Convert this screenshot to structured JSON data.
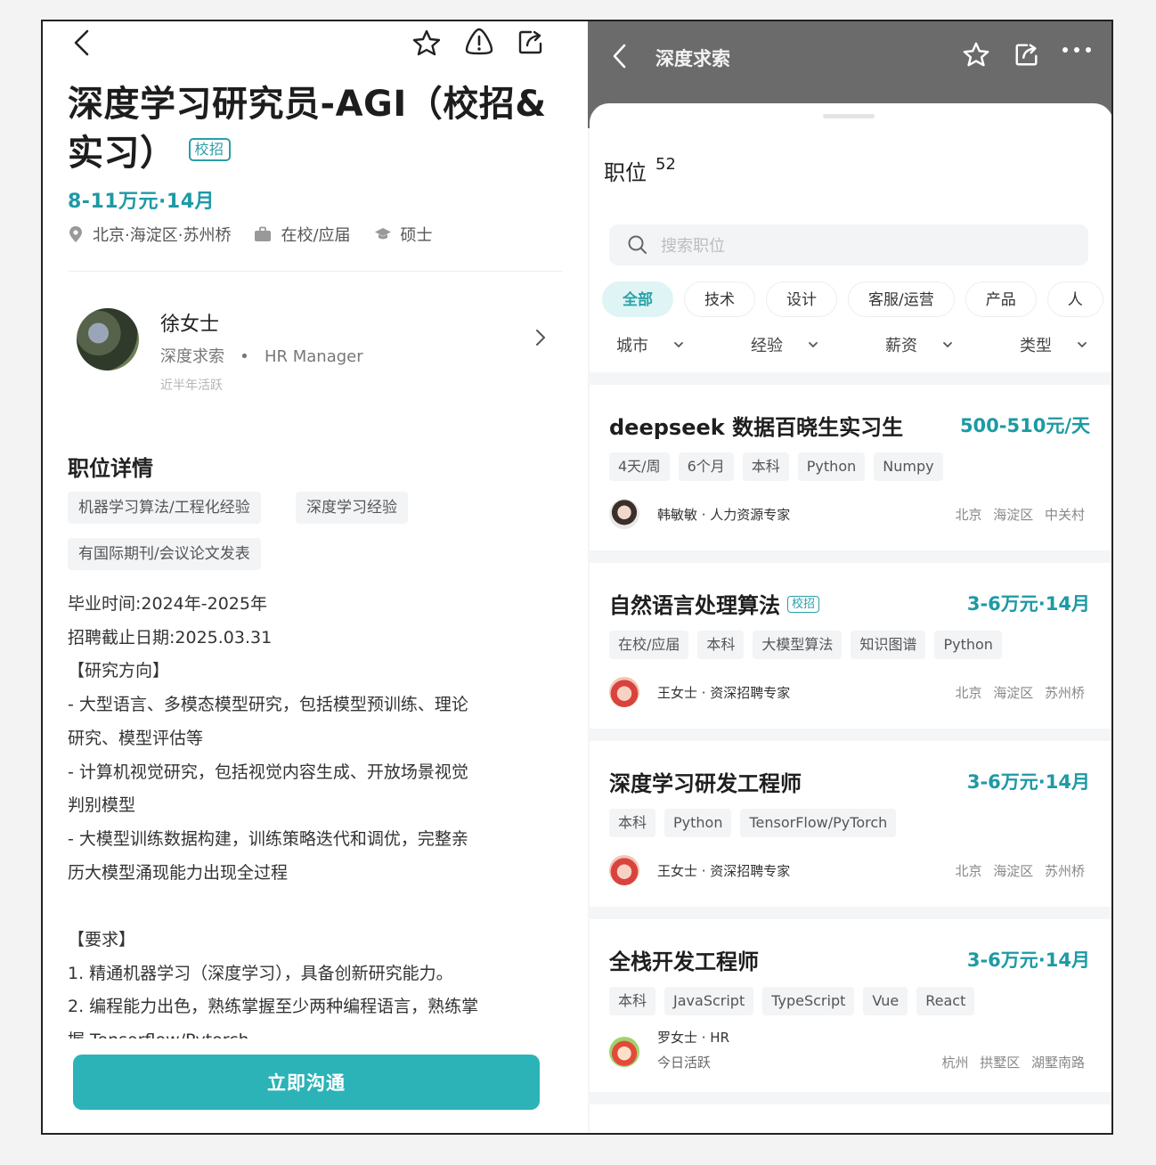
{
  "colors": {
    "accent": "#1d9aa4",
    "button": "#2bb3b8",
    "header_gray": "#6b6b6b"
  },
  "left": {
    "icons": [
      "back-icon",
      "star-icon",
      "alert-icon",
      "share-icon"
    ],
    "title": "深度学习研究员-AGI（校招&实习）",
    "title_badge": "校招",
    "salary": "8-11万元·14月",
    "location": "北京·海淀区·苏州桥",
    "status": "在校/应届",
    "degree": "硕士",
    "hr": {
      "name": "徐女士",
      "company": "深度求索",
      "role": "HR Manager",
      "active": "近半年活跃"
    },
    "detail_heading": "职位详情",
    "skills": [
      "机器学习算法/工程化经验",
      "深度学习经验",
      "有国际期刊/会议论文发表"
    ],
    "description": [
      "毕业时间:2024年-2025年",
      "招聘截止日期:2025.03.31",
      "【研究方向】",
      "-  大型语言、多模态模型研究，包括模型预训练、理论",
      "研究、模型评估等",
      "-  计算机视觉研究，包括视觉内容生成、开放场景视觉",
      "判别模型",
      "-  大模型训练数据构建，训练策略迭代和调优，完整亲",
      "历大模型涌现能力出现全过程",
      "",
      "【要求】",
      "1. 精通机器学习（深度学习），具备创新研究能力。",
      "2. 编程能力出色，熟练掌握至少两种编程语言，熟练掌",
      "握 Tensorflow/Pytorch"
    ],
    "chat_button": "立即沟通"
  },
  "right": {
    "header_title": "深度求索",
    "positions_label": "职位",
    "positions_count": "52",
    "search_placeholder": "搜索职位",
    "categories": [
      "全部",
      "技术",
      "设计",
      "客服/运营",
      "产品",
      "人"
    ],
    "filters": [
      "城市",
      "经验",
      "薪资",
      "类型"
    ],
    "jobs": [
      {
        "title": "deepseek 数据百晓生实习生",
        "badge": "",
        "salary": "500-510元/天",
        "tags": [
          "4天/周",
          "6个月",
          "本科",
          "Python",
          "Numpy"
        ],
        "recruiter": "韩敏敏 · 人力资源专家",
        "active": "",
        "location": "北京 海淀区 中关村"
      },
      {
        "title": "自然语言处理算法",
        "badge": "校招",
        "salary": "3-6万元·14月",
        "tags": [
          "在校/应届",
          "本科",
          "大模型算法",
          "知识图谱",
          "Python"
        ],
        "recruiter": "王女士 · 资深招聘专家",
        "active": "",
        "location": "北京 海淀区 苏州桥"
      },
      {
        "title": "深度学习研发工程师",
        "badge": "",
        "salary": "3-6万元·14月",
        "tags": [
          "本科",
          "Python",
          "TensorFlow/PyTorch"
        ],
        "recruiter": "王女士 · 资深招聘专家",
        "active": "",
        "location": "北京 海淀区 苏州桥"
      },
      {
        "title": "全栈开发工程师",
        "badge": "",
        "salary": "3-6万元·14月",
        "tags": [
          "本科",
          "JavaScript",
          "TypeScript",
          "Vue",
          "React"
        ],
        "recruiter": "罗女士 · HR",
        "active": "今日活跃",
        "location": "杭州 拱墅区 湖墅南路"
      }
    ]
  }
}
